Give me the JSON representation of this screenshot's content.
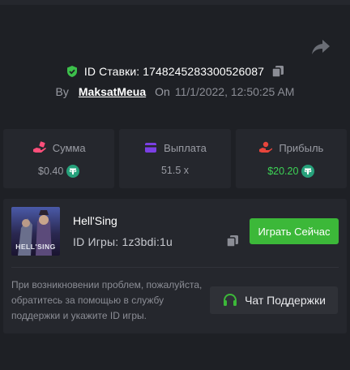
{
  "bet": {
    "id_label": "ID Ставки: 1748245283300526087",
    "by_label": "By",
    "username": "MaksatMeua",
    "on_label": "On",
    "datetime": "11/1/2022, 12:50:25 AM"
  },
  "stats": [
    {
      "label": "Сумма",
      "value": "$0.40",
      "icon": "hand-coin-icon",
      "currency_icon": "tether-icon"
    },
    {
      "label": "Выплата",
      "value": "51.5 x",
      "icon": "wallet-card-icon"
    },
    {
      "label": "Прибыль",
      "value": "$20.20",
      "icon": "profit-hand-icon",
      "currency_icon": "tether-icon"
    }
  ],
  "game": {
    "name": "Hell'Sing",
    "id_label": "ID Игры: 1z3bdi:1u",
    "thumbnail_text": "HELL'SING",
    "play_label": "Играть Сейчас"
  },
  "help": {
    "text": "При возникновении проблем, пожалуйста, обратитесь за помощью в службу поддержки и укажите ID игры.",
    "support_label": "Чат Поддержки"
  },
  "colors": {
    "background": "#1e2025",
    "panel": "#25272d",
    "accent_green": "#3cb839",
    "profit_green": "#3dd356",
    "tether": "#26a17b",
    "shield": "#3cc04b",
    "stake_icon": "#ff4f7b",
    "payout_icon": "#7b3fe4",
    "profit_icon": "#e8453c"
  }
}
